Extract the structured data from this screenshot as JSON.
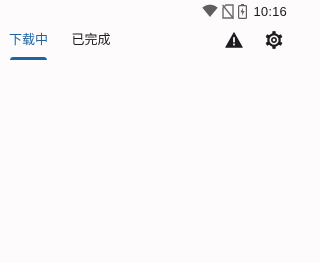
{
  "status_bar": {
    "time": "10:16",
    "icons": [
      "wifi-icon",
      "no-sim-icon",
      "battery-charging-icon"
    ]
  },
  "tabs": [
    {
      "label": "下载中",
      "selected": true
    },
    {
      "label": "已完成",
      "selected": false
    }
  ],
  "actions": {
    "warning_icon": "warning-icon",
    "settings_icon": "gear-icon"
  },
  "colors": {
    "accent": "#1c64a3",
    "background": "#fdfbfc",
    "text": "#1d1b1e"
  }
}
